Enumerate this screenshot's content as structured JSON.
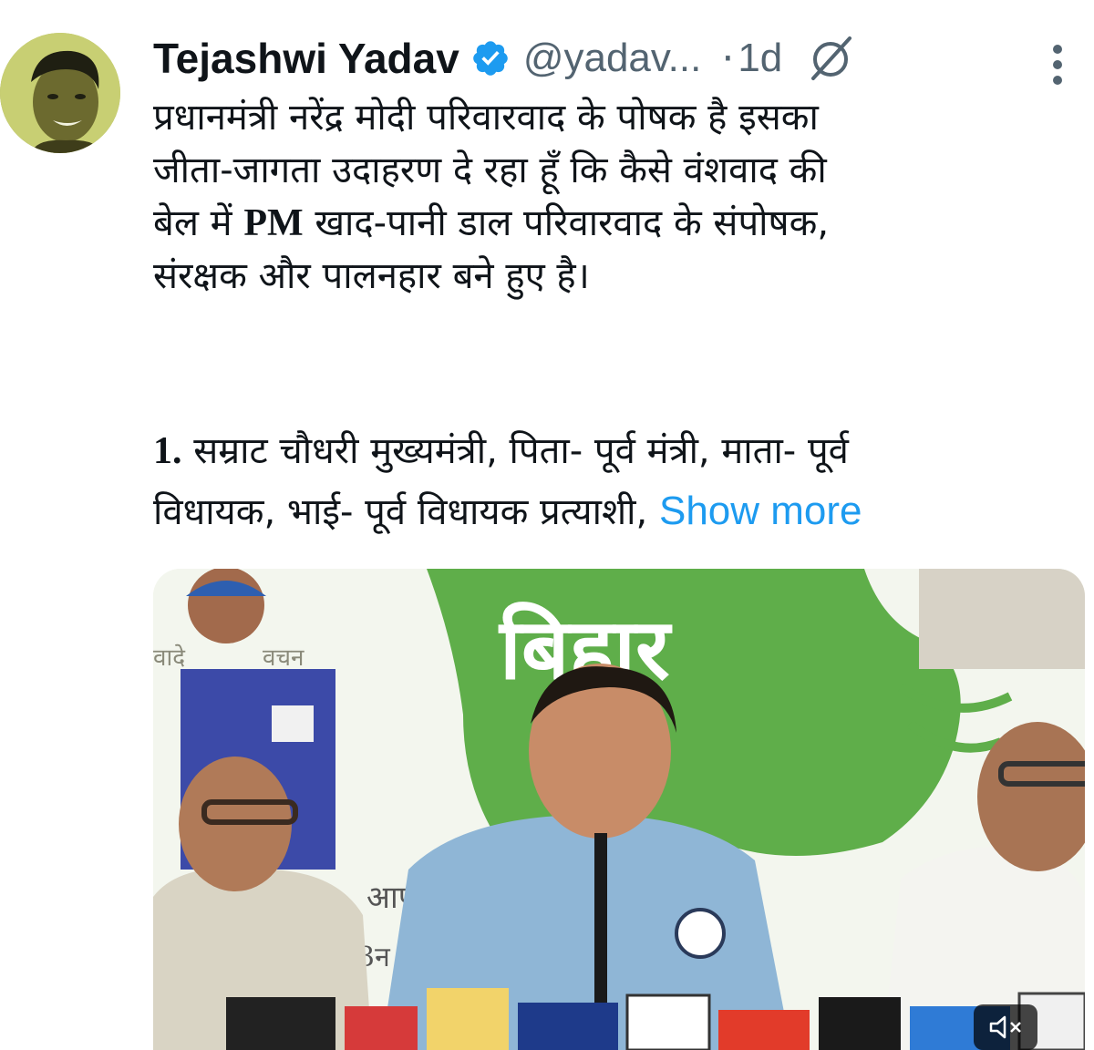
{
  "user": {
    "name": "Tejashwi Yadav",
    "handle": "@yadav...",
    "time_separator": "·",
    "time": "1d"
  },
  "tweet": {
    "line1": "प्रधानमंत्री नरेंद्र मोदी परिवारवाद के पोषक है इसका",
    "line2": "जीता-जागता उदाहरण दे रहा हूँ कि कैसे वंशवाद की",
    "line3_pre": "बेल में ",
    "line3_pm": "PM",
    "line3_post": " खाद-पानी डाल परिवारवाद के संपोषक,",
    "line4": "संरक्षक और पालनहार बने हुए है।",
    "item1_num": "1.",
    "item1_text": " सम्राट चौधरी मुख्यमंत्री, पिता- पूर्व मंत्री, माता- पूर्व",
    "item1_line2": "विधायक, भाई- पूर्व विधायक प्रत्याशी, ",
    "show_more": "Show more"
  },
  "media": {
    "banner_word": "बिहार",
    "banner_left": "वादे",
    "banner_left2": "वचन",
    "poster_text1": "आप",
    "poster_text2": "3न"
  },
  "icons": {
    "verified": "verified-badge-icon",
    "grok": "grok-icon",
    "more": "more-options-icon",
    "mute": "mute-icon"
  },
  "colors": {
    "accent": "#1d9bf0",
    "secondary_text": "#536471",
    "primary_text": "#0f1419"
  }
}
